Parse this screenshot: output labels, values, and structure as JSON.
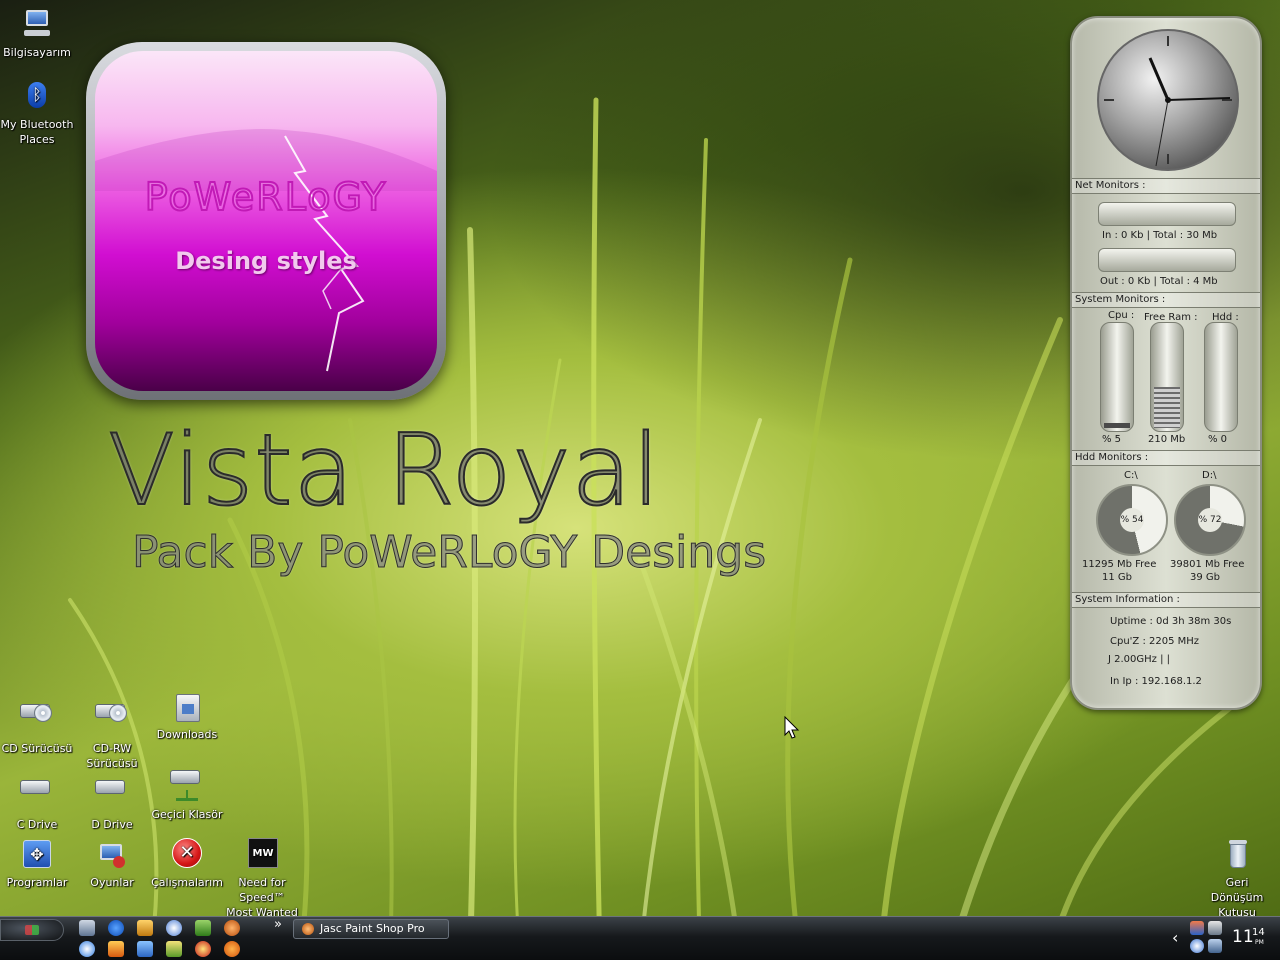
{
  "desktop": {
    "top_icons": [
      {
        "label": "Bilgisayarım"
      },
      {
        "label": "My Bluetooth Places"
      }
    ],
    "bottom_icons": [
      {
        "label": "CD Sürücüsü"
      },
      {
        "label": "CD-RW Sürücüsü"
      },
      {
        "label": "Downloads"
      },
      {
        "label": "C Drive"
      },
      {
        "label": "D Drive"
      },
      {
        "label": "Geçici Klasör"
      },
      {
        "label": "Programlar"
      },
      {
        "label": "Oyunlar"
      },
      {
        "label": "Çalışmalarım"
      },
      {
        "label": "Need for Speed™ Most Wanted PC"
      }
    ],
    "recycle_bin": {
      "label": "Geri Dönüşüm Kutusu"
    }
  },
  "logo": {
    "title": "PoWeRLoGY",
    "subtitle": "Desing styles"
  },
  "hero": {
    "title": "Vista Royal",
    "subtitle": "Pack By PoWeRLoGY Desings"
  },
  "gadget": {
    "net_header": "Net Monitors :",
    "net_in": "In  : 0 Kb  | Total : 30 Mb",
    "net_out": "Out : 0 Kb  | Total : 4 Mb",
    "sys_header": "System Monitors  :",
    "cpu_label": "Cpu :",
    "ram_label": "Free Ram :",
    "hdd_label": "Hdd :",
    "cpu_value": "% 5",
    "ram_value": "210 Mb",
    "hdd_value": "% 0",
    "cpu_level": 0.05,
    "ram_level": 0.4,
    "hdd_level": 0.0,
    "hdd_header": "Hdd Monitors  :",
    "drive_c": {
      "label": "C:\\",
      "percent": "% 54",
      "level": 0.54,
      "free": "11295 Mb Free",
      "size": "11 Gb"
    },
    "drive_d": {
      "label": "D:\\",
      "percent": "% 72",
      "level": 0.72,
      "free": "39801 Mb Free",
      "size": "39 Gb"
    },
    "info_header": "System Information  :",
    "uptime": "Uptime : 0d 3h 38m 30s",
    "cpu_speed": "Cpu'Z   : 2205 MHz",
    "cpu_name": "J 2.00GHz |             |",
    "ip": "In Ip : 192.168.1.2"
  },
  "taskbar": {
    "active_task": "Jasc Paint Shop Pro",
    "clock_time": "11",
    "clock_min": "14",
    "clock_ampm": "PM",
    "expand_arrow": "»",
    "tray_arrow": "‹"
  }
}
